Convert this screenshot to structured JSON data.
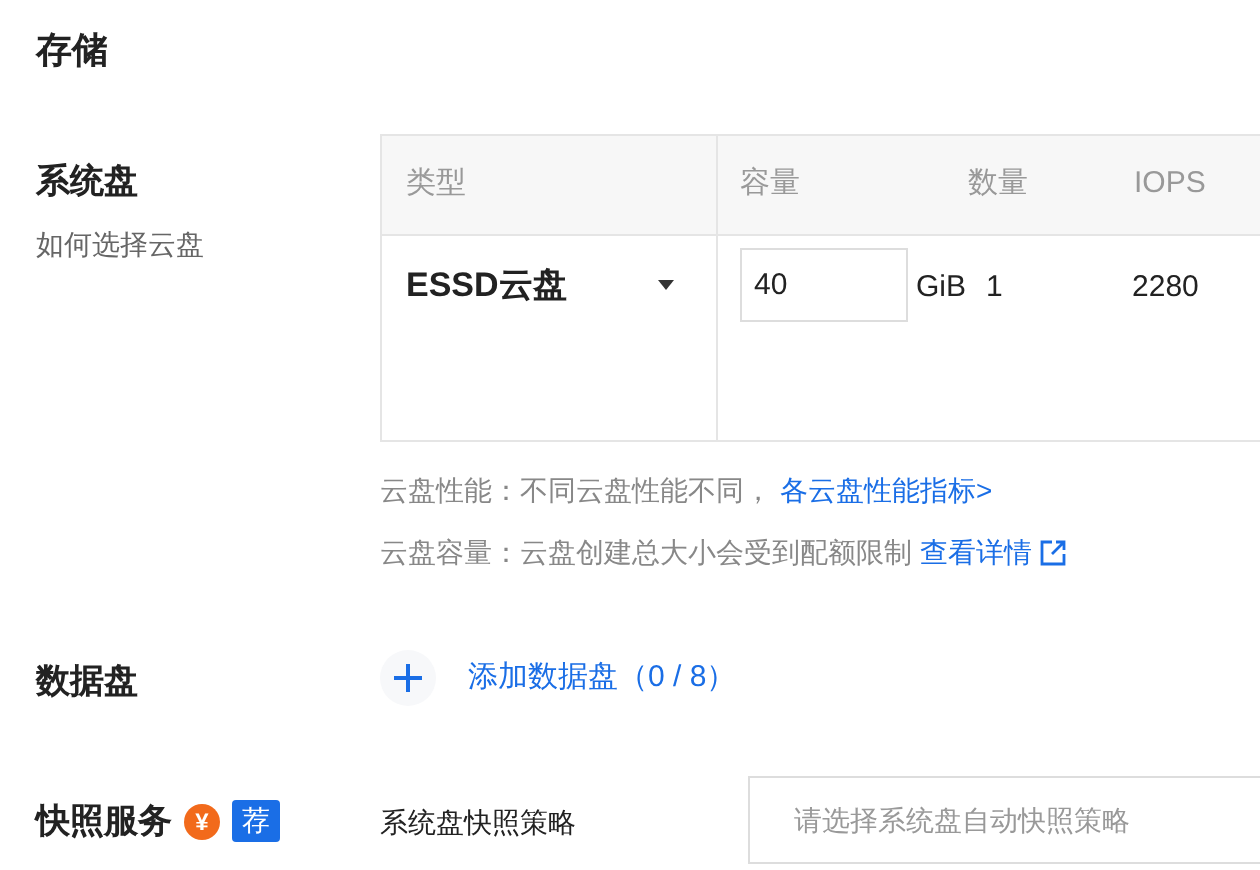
{
  "section_title": "存储",
  "system_disk": {
    "label": "系统盘",
    "help_text": "如何选择云盘",
    "table": {
      "columns": [
        "类型",
        "容量",
        "数量",
        "IOPS"
      ],
      "row": {
        "type": "ESSD云盘",
        "capacity": "40",
        "unit": "GiB",
        "count": "1",
        "iops": "2280"
      }
    },
    "notes": [
      {
        "text": "云盘性能：不同云盘性能不同，",
        "link": "各云盘性能指标>",
        "external": false
      },
      {
        "text": "云盘容量：云盘创建总大小会受到配额限制 ",
        "link": "查看详情",
        "external": true
      }
    ]
  },
  "data_disk": {
    "label": "数据盘",
    "add_button": "添加数据盘（0 / 8）"
  },
  "snapshot": {
    "label": "快照服务",
    "price_icon": "¥",
    "badge": "荐",
    "policy_label": "系统盘快照策略",
    "policy_placeholder": "请选择系统盘自动快照策略"
  }
}
